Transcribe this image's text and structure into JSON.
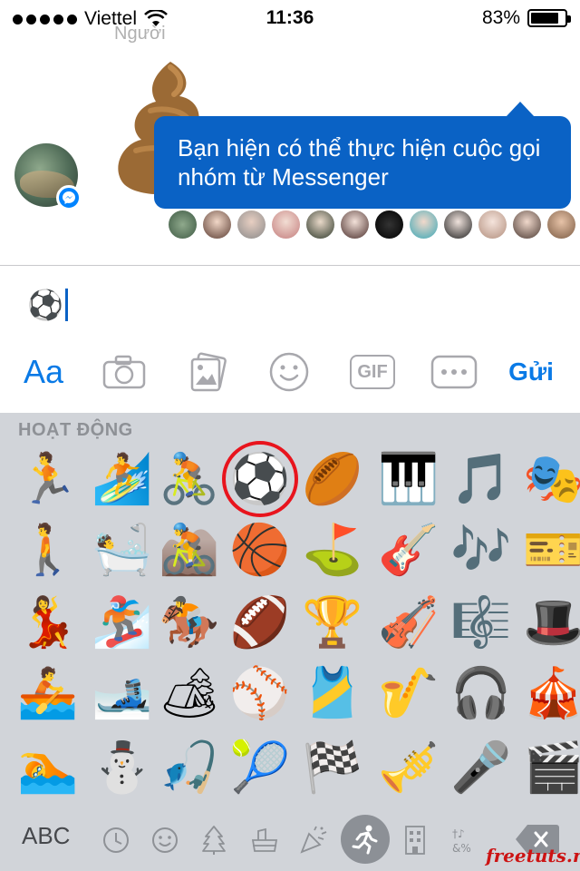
{
  "status_bar": {
    "carrier": "Viettel",
    "time": "11:36",
    "battery": "83%",
    "battery_level": 0.83
  },
  "faded_header": "Người",
  "tooltip": {
    "text": "Bạn hiện có thể thực hiện cuộc gọi nhóm từ Messenger"
  },
  "composer": {
    "value": "⚽"
  },
  "toolbar": {
    "text_button": "Aa",
    "gif_label": "GIF",
    "send_label": "Gửi"
  },
  "keyboard": {
    "section_title": "HOẠT ĐỘNG",
    "abc_label": "ABC",
    "selected_emoji": "soccer-ball",
    "emojis": [
      [
        "🏃",
        "🏄",
        "🚴",
        "⚽",
        "🏉",
        "🎹",
        "🎵",
        "🎭"
      ],
      [
        "🚶",
        "🛀",
        "🚵",
        "🏀",
        "⛳",
        "🎸",
        "🎶",
        "🎫"
      ],
      [
        "💃",
        "🏂",
        "🏇",
        "🏈",
        "🏆",
        "🎻",
        "🎼",
        "🎩"
      ],
      [
        "🚣",
        "🎿",
        "🏕",
        "⚾",
        "🎽",
        "🎷",
        "🎧",
        "🎪"
      ],
      [
        "🏊",
        "⛄",
        "🎣",
        "🎾",
        "🏁",
        "🎺",
        "🎤",
        "🎬"
      ]
    ],
    "categories": [
      "recent-icon",
      "smiley-icon",
      "nature-icon",
      "food-icon",
      "celebration-icon",
      "activity-icon",
      "travel-icon",
      "symbols-icon"
    ]
  },
  "watermark": "freetuts.net",
  "colors": {
    "accent": "#0a7ae6",
    "tooltip_bg": "#0a62c5",
    "keyboard_bg": "#d1d4d9",
    "selection_ring": "#e8141d"
  }
}
